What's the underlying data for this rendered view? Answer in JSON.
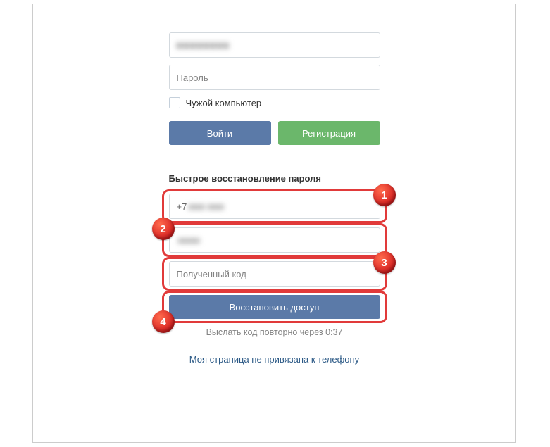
{
  "login": {
    "username_blurred": "■■■■■■■■",
    "password_placeholder": "Пароль",
    "foreign_computer_label": "Чужой компьютер",
    "login_button": "Войти",
    "register_button": "Регистрация"
  },
  "recovery": {
    "title": "Быстрое восстановление пароля",
    "phone_prefix": "+7",
    "phone_blurred": "■■■ ■■■",
    "name_blurred": "■■■■",
    "code_placeholder": "Полученный код",
    "restore_button": "Восстановить доступ",
    "resend_text": "Выслать код повторно через 0:37",
    "not_linked_link": "Моя страница не привязана к телефону"
  },
  "markers": {
    "m1": "1",
    "m2": "2",
    "m3": "3",
    "m4": "4"
  }
}
